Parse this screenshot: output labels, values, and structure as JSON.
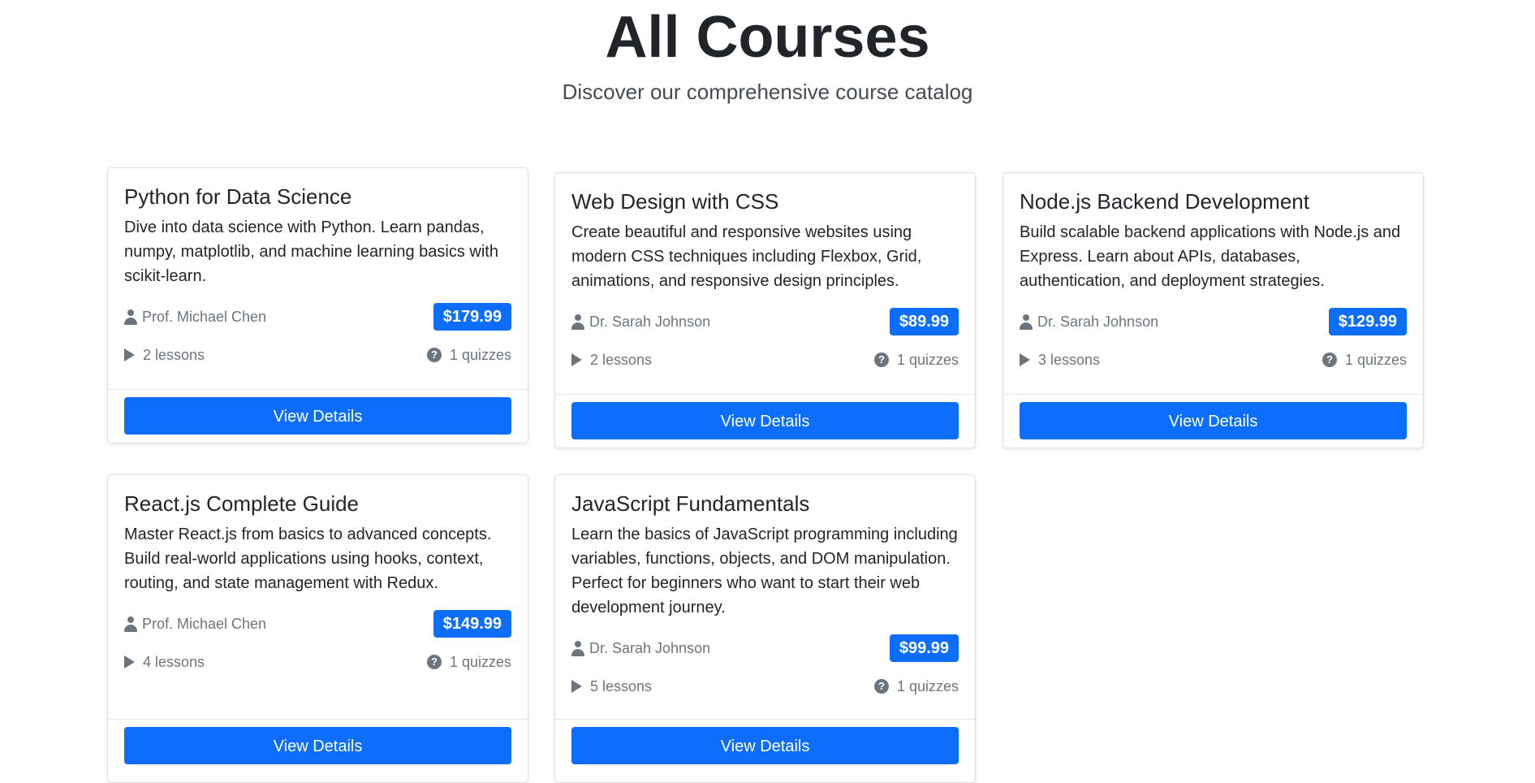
{
  "header": {
    "title": "All Courses",
    "subtitle": "Discover our comprehensive course catalog"
  },
  "courses": [
    {
      "title": "Python for Data Science",
      "description": "Dive into data science with Python. Learn pandas, numpy, matplotlib, and machine learning basics with scikit-learn.",
      "instructor": "Prof. Michael Chen",
      "price": "$179.99",
      "lessons": "2 lessons",
      "quizzes": "1 quizzes",
      "button_label": "View Details"
    },
    {
      "title": "Web Design with CSS",
      "description": "Create beautiful and responsive websites using modern CSS techniques including Flexbox, Grid, animations, and responsive design principles.",
      "instructor": "Dr. Sarah Johnson",
      "price": "$89.99",
      "lessons": "2 lessons",
      "quizzes": "1 quizzes",
      "button_label": "View Details"
    },
    {
      "title": "Node.js Backend Development",
      "description": "Build scalable backend applications with Node.js and Express. Learn about APIs, databases, authentication, and deployment strategies.",
      "instructor": "Dr. Sarah Johnson",
      "price": "$129.99",
      "lessons": "3 lessons",
      "quizzes": "1 quizzes",
      "button_label": "View Details"
    },
    {
      "title": "React.js Complete Guide",
      "description": "Master React.js from basics to advanced concepts. Build real-world applications using hooks, context, routing, and state management with Redux.",
      "instructor": "Prof. Michael Chen",
      "price": "$149.99",
      "lessons": "4 lessons",
      "quizzes": "1 quizzes",
      "button_label": "View Details"
    },
    {
      "title": "JavaScript Fundamentals",
      "description": "Learn the basics of JavaScript programming including variables, functions, objects, and DOM manipulation. Perfect for beginners who want to start their web development journey.",
      "instructor": "Dr. Sarah Johnson",
      "price": "$99.99",
      "lessons": "5 lessons",
      "quizzes": "1 quizzes",
      "button_label": "View Details"
    }
  ],
  "colors": {
    "primary": "#0d6efd",
    "muted": "#6c757d"
  }
}
